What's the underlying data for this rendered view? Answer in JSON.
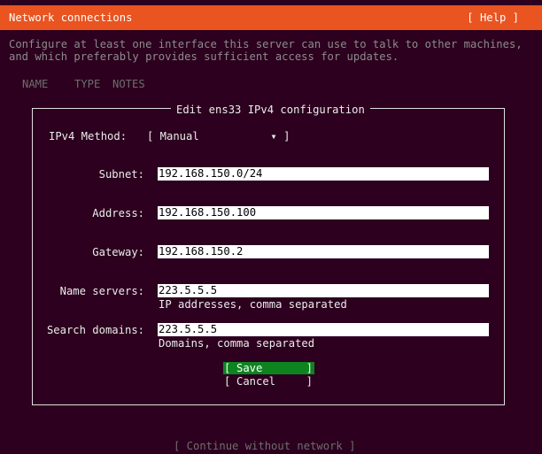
{
  "header": {
    "title": "Network connections",
    "help": "[ Help ]"
  },
  "intro": {
    "line1": "Configure at least one interface this server can use to talk to other machines,",
    "line2": "and which preferably provides sufficient access for updates."
  },
  "columns": {
    "name": "NAME",
    "type": "TYPE",
    "notes": "NOTES"
  },
  "dialog": {
    "title": "Edit ens33 IPv4 configuration",
    "method": {
      "label": "IPv4 Method:",
      "value": "[ Manual           ▾ ]"
    },
    "subnet": {
      "label": "Subnet:",
      "value": "192.168.150.0/24"
    },
    "address": {
      "label": "Address:",
      "value": "192.168.150.100"
    },
    "gateway": {
      "label": "Gateway:",
      "value": "192.168.150.2"
    },
    "nameservers": {
      "label": "Name servers:",
      "value": "223.5.5.5",
      "hint": "IP addresses, comma separated"
    },
    "searchdomains": {
      "label": "Search domains:",
      "value": "223.5.5.5",
      "hint": "Domains, comma separated"
    },
    "save": "Save",
    "cancel": "Cancel"
  },
  "footer": {
    "continue": "[ Continue without network ]"
  },
  "colors": {
    "header": "#e95420",
    "background": "#2c001e",
    "save_button": "#0e8420"
  }
}
